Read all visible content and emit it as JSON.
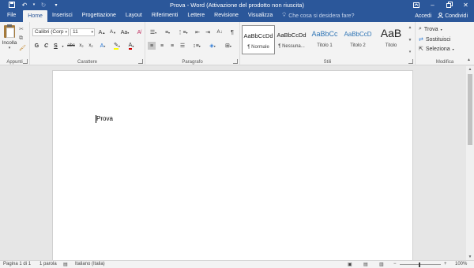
{
  "titlebar": {
    "title": "Prova - Word (Attivazione del prodotto non riuscita)",
    "qat": {
      "save_icon": "save-icon",
      "undo_icon": "undo-icon",
      "redo_icon": "redo-icon",
      "customize_icon": "chevron-down-icon"
    },
    "window_buttons": {
      "ribbon_options_icon": "ribbon-display-icon",
      "minimize_icon": "minimize-icon",
      "restore_icon": "restore-icon",
      "close_icon": "close-icon"
    }
  },
  "tabs": [
    {
      "label": "File"
    },
    {
      "label": "Home",
      "active": true
    },
    {
      "label": "Inserisci"
    },
    {
      "label": "Progettazione"
    },
    {
      "label": "Layout"
    },
    {
      "label": "Riferimenti"
    },
    {
      "label": "Lettere"
    },
    {
      "label": "Revisione"
    },
    {
      "label": "Visualizza"
    }
  ],
  "tellme": {
    "placeholder": "Che cosa si desidera fare?"
  },
  "account": {
    "signin": "Accedi",
    "share": "Condividi"
  },
  "ribbon": {
    "clipboard": {
      "paste": "Incolla",
      "label": "Appunti"
    },
    "font": {
      "name": "Calibri (Corp",
      "size": "11",
      "label": "Carattere",
      "bold": "G",
      "italic": "C",
      "underline": "S"
    },
    "paragraph": {
      "label": "Paragrafo"
    },
    "styles": {
      "label": "Stili",
      "items": [
        {
          "sample": "AaBbCcDd",
          "name": "¶ Normale",
          "selected": true
        },
        {
          "sample": "AaBbCcDd",
          "name": "¶ Nessuna..."
        },
        {
          "sample": "AaBbCc",
          "name": "Titolo 1"
        },
        {
          "sample": "AaBbCcD",
          "name": "Titolo 2"
        },
        {
          "sample": "AaB",
          "name": "Titolo"
        }
      ]
    },
    "editing": {
      "label": "Modifica",
      "find": "Trova",
      "replace": "Sostituisci",
      "select": "Seleziona"
    }
  },
  "document": {
    "text": "Prova"
  },
  "statusbar": {
    "page": "Pagina 1 di 1",
    "words": "1 parola",
    "language": "Italiano (Italia)",
    "zoom": "100%"
  },
  "colors": {
    "accent": "#2b579a",
    "ribbon_bg": "#f3f3f3",
    "doc_bg": "#e6e6e6",
    "highlight": "#ffff00",
    "font_color": "#d00000"
  }
}
